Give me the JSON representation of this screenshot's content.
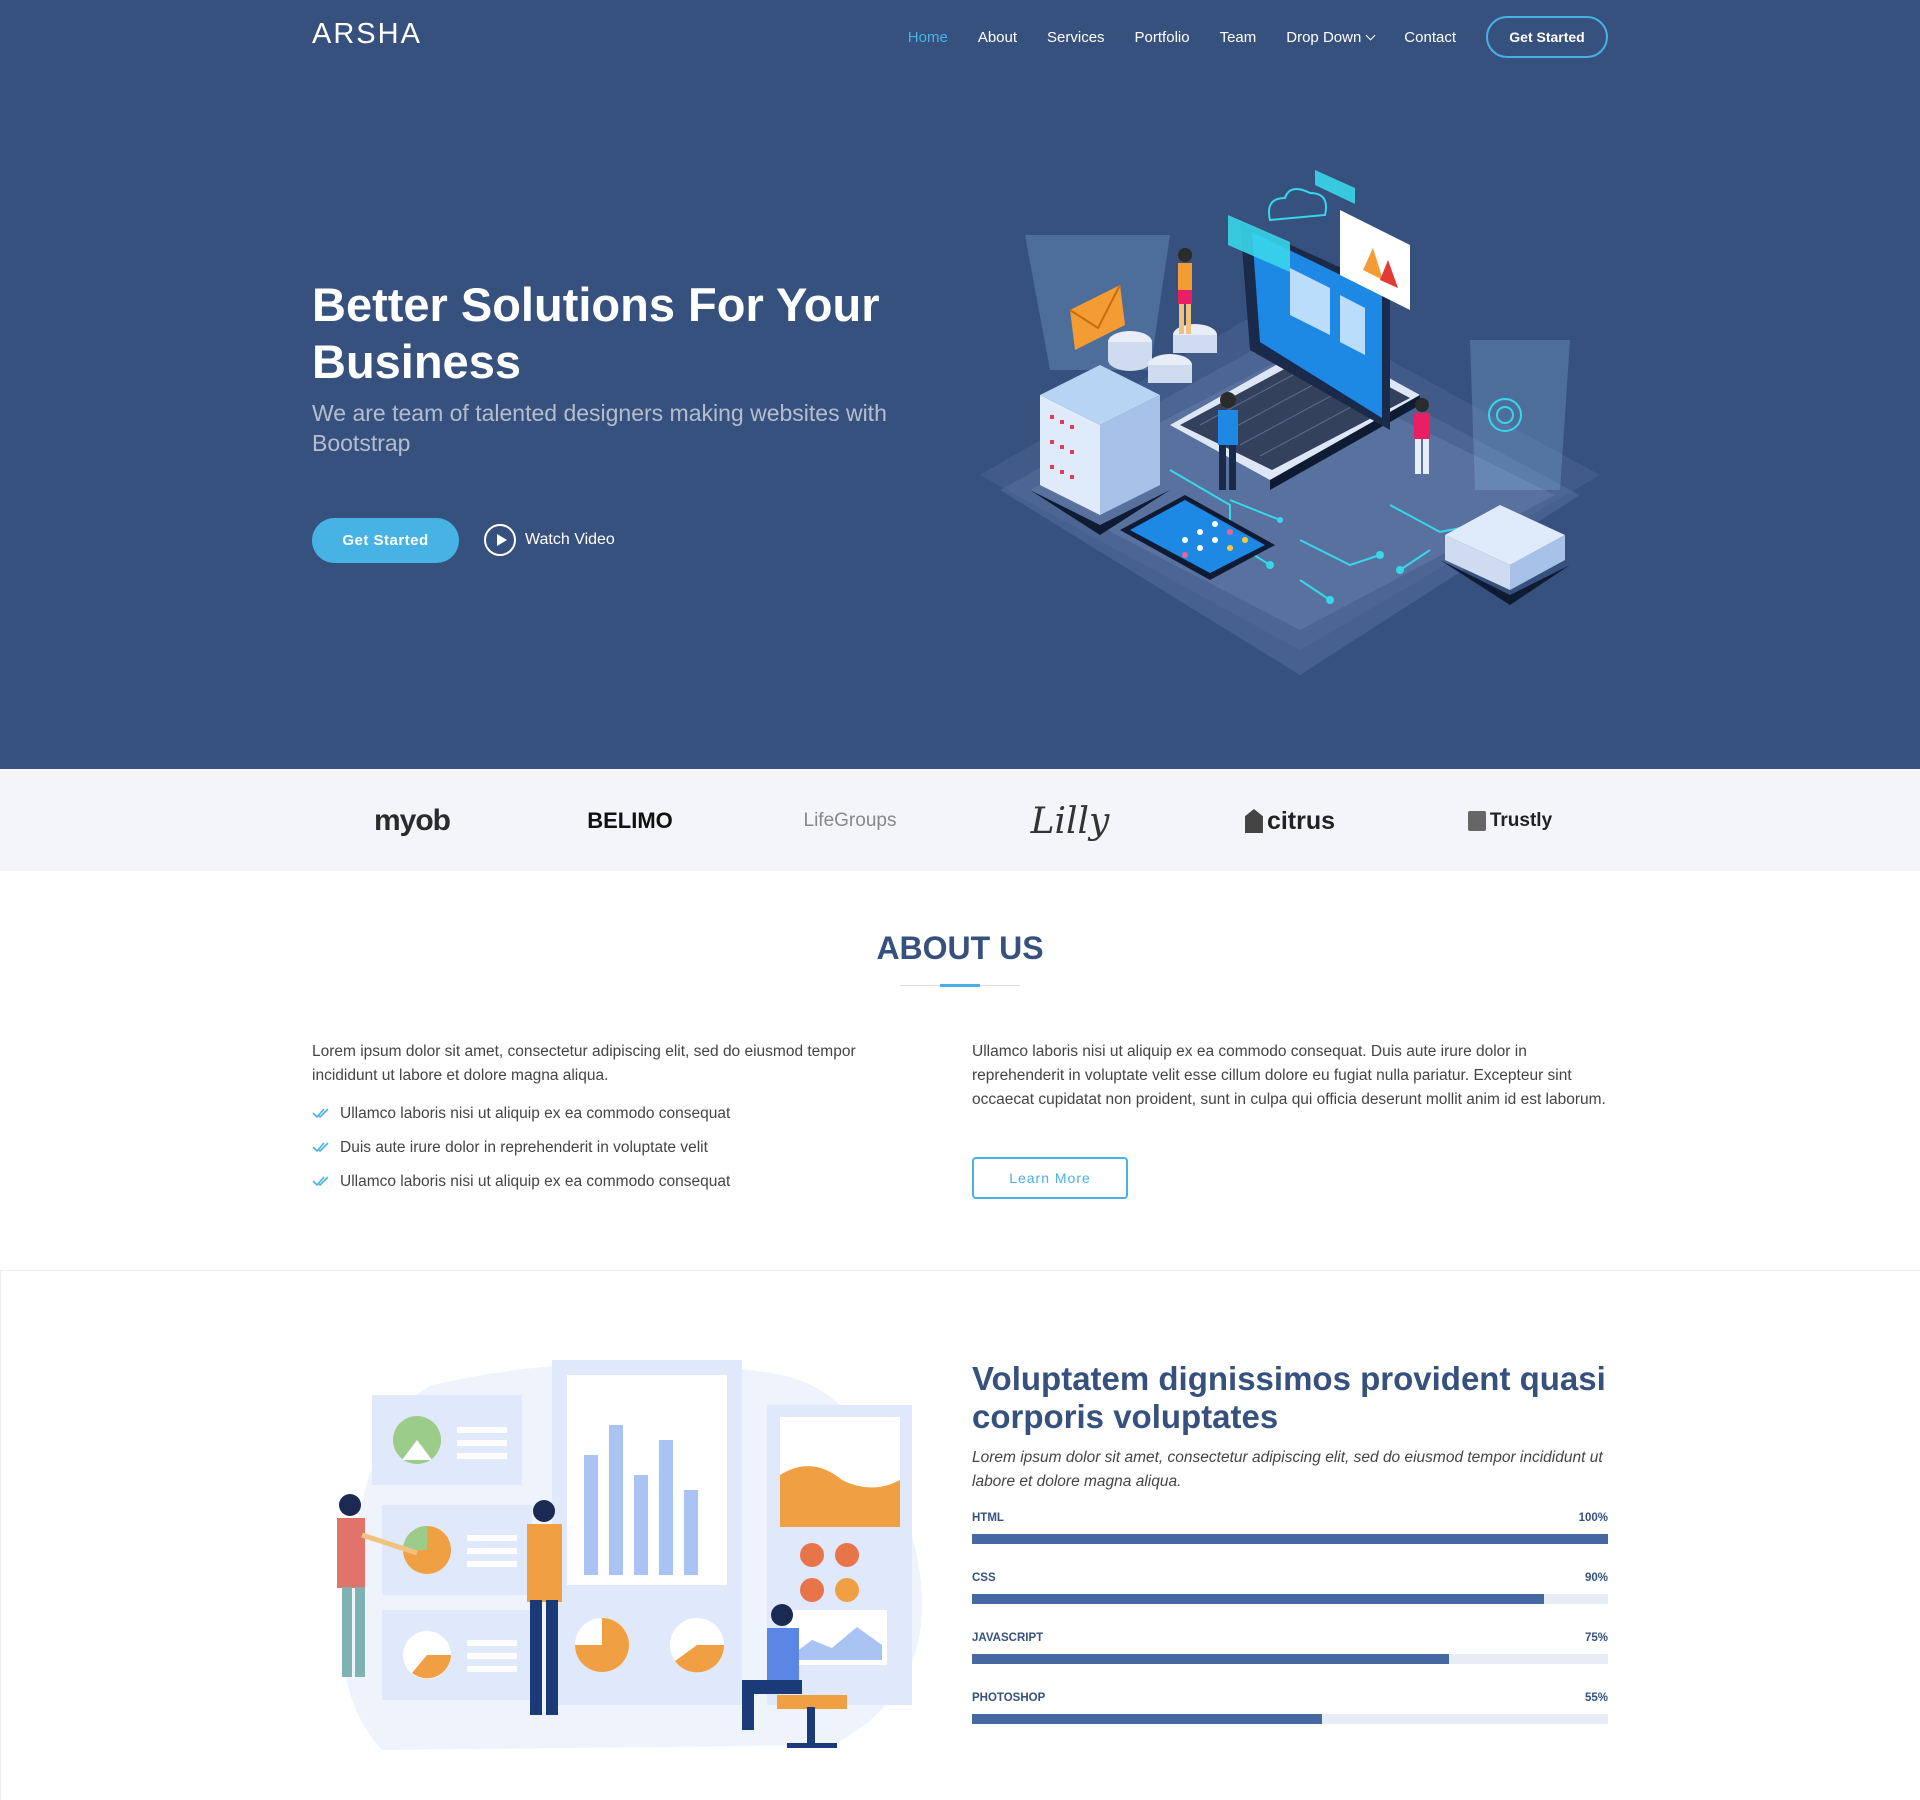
{
  "brand": "ARSHA",
  "nav": {
    "items": [
      {
        "label": "Home",
        "active": true
      },
      {
        "label": "About"
      },
      {
        "label": "Services"
      },
      {
        "label": "Portfolio"
      },
      {
        "label": "Team"
      },
      {
        "label": "Drop Down",
        "dropdown": true
      },
      {
        "label": "Contact"
      }
    ],
    "cta": "Get Started"
  },
  "hero": {
    "title": "Better Solutions For Your Business",
    "subtitle": "We are team of talented designers making websites with Bootstrap",
    "primary_button": "Get Started",
    "video_link": "Watch Video"
  },
  "clients": [
    "myob",
    "BELIMO",
    "LifeGroups",
    "Lilly",
    "citrus",
    "Trustly"
  ],
  "about": {
    "title": "ABOUT US",
    "left_text": "Lorem ipsum dolor sit amet, consectetur adipiscing elit, sed do eiusmod tempor incididunt ut labore et dolore magna aliqua.",
    "list": [
      "Ullamco laboris nisi ut aliquip ex ea commodo consequat",
      "Duis aute irure dolor in reprehenderit in voluptate velit",
      "Ullamco laboris nisi ut aliquip ex ea commodo consequat"
    ],
    "right_text": "Ullamco laboris nisi ut aliquip ex ea commodo consequat. Duis aute irure dolor in reprehenderit in voluptate velit esse cillum dolore eu fugiat nulla pariatur. Excepteur sint occaecat cupidatat non proident, sunt in culpa qui officia deserunt mollit anim id est laborum.",
    "button": "Learn More"
  },
  "skills": {
    "title": "Voluptatem dignissimos provident quasi corporis voluptates",
    "subtitle": "Lorem ipsum dolor sit amet, consectetur adipiscing elit, sed do eiusmod tempor incididunt ut labore et dolore magna aliqua.",
    "items": [
      {
        "name": "HTML",
        "label": "100%",
        "value": 100
      },
      {
        "name": "CSS",
        "label": "90%",
        "value": 90
      },
      {
        "name": "JAVASCRIPT",
        "label": "75%",
        "value": 75
      },
      {
        "name": "PHOTOSHOP",
        "label": "55%",
        "value": 55
      }
    ]
  },
  "colors": {
    "hero_bg": "#37517e",
    "accent": "#47b2e4",
    "clients_bg": "#f3f5fa",
    "bar_fill": "#4668a2",
    "bar_track": "#e8edf5"
  }
}
